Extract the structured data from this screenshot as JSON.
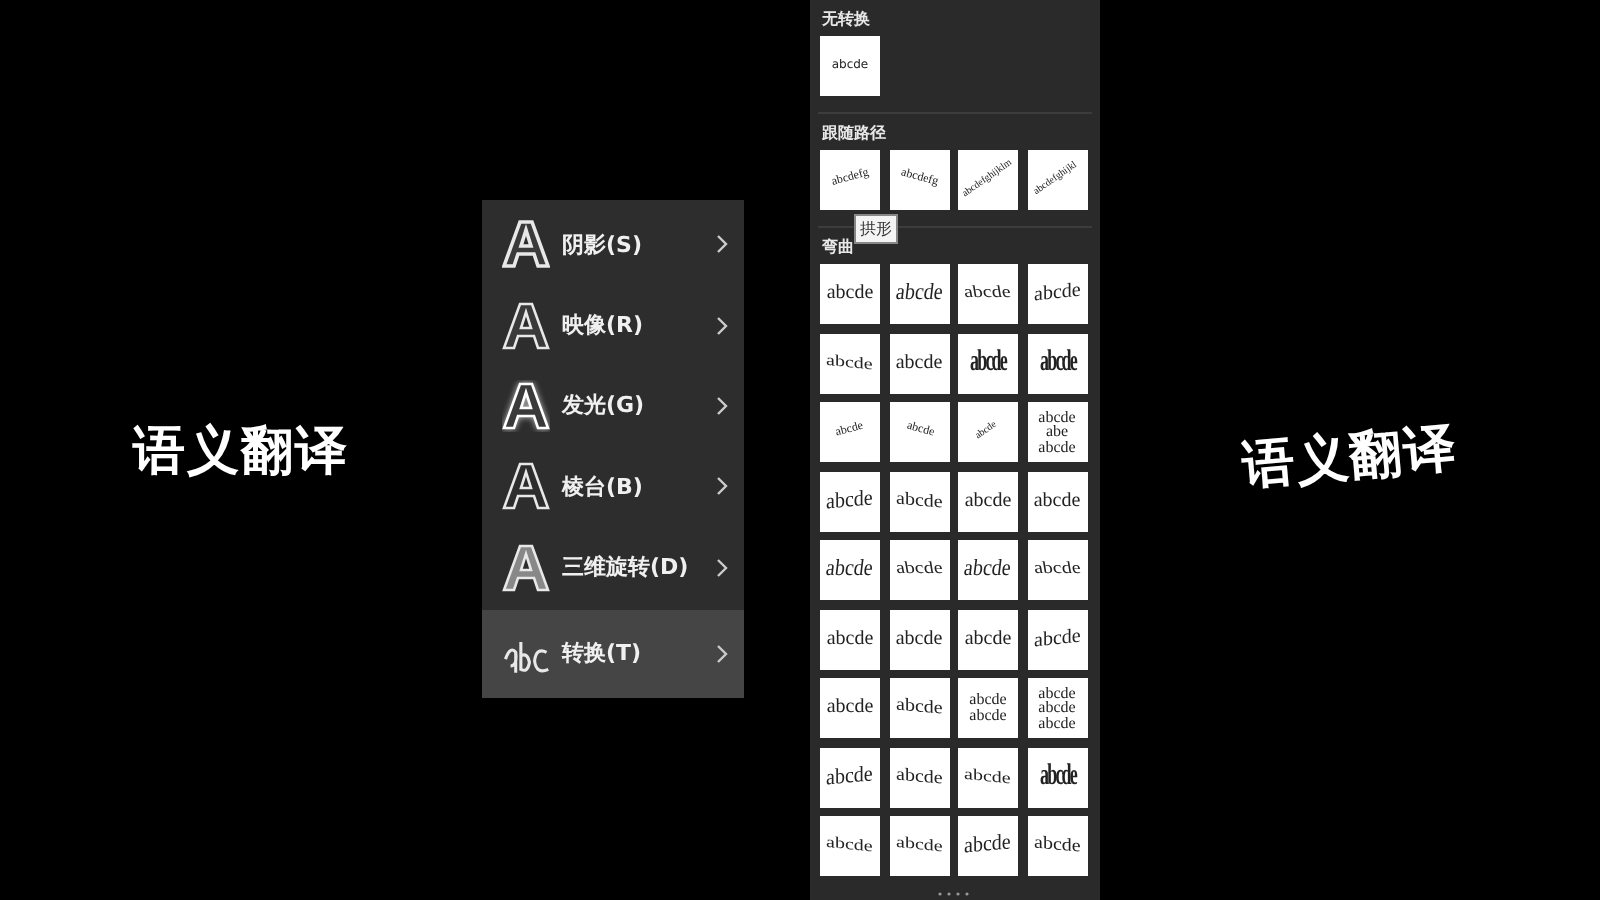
{
  "captions": [
    {
      "text": "语义翻译",
      "kind": "plain"
    },
    {
      "text": "语义翻译",
      "kind": "tilted"
    }
  ],
  "menu": {
    "items": [
      {
        "label": "阴影(S)",
        "kind": "effect",
        "selected": false
      },
      {
        "label": "映像(R)",
        "kind": "effect",
        "selected": false
      },
      {
        "label": "发光(G)",
        "kind": "effect",
        "selected": false
      },
      {
        "label": "棱台(B)",
        "kind": "effect",
        "selected": false
      },
      {
        "label": "三维旋转(D)",
        "kind": "effect",
        "selected": false
      },
      {
        "label": "转换(T)",
        "kind": "warp",
        "selected": true
      }
    ]
  },
  "gallery": {
    "sections": [
      {
        "title": "无转换",
        "tiles": [
          {
            "kind": "tiny",
            "lines": [
              "abcde"
            ]
          }
        ]
      },
      {
        "title": "跟随路径",
        "tiles": [
          {
            "kind": "arc-up",
            "lines": [
              "abcdefg"
            ]
          },
          {
            "kind": "arc-down",
            "lines": [
              "abcdefg"
            ]
          },
          {
            "kind": "circle",
            "lines": [
              "abcdefghijklm"
            ]
          },
          {
            "kind": "circle",
            "lines": [
              "abcdefghijkl"
            ]
          }
        ],
        "tooltip": "拱形"
      },
      {
        "title": "弯曲",
        "tiles": [
          {
            "kind": "plain",
            "lines": [
              "abcde"
            ]
          },
          {
            "kind": "arch-up",
            "lines": [
              "abcde"
            ]
          },
          {
            "kind": "arch-down",
            "lines": [
              "abcde"
            ]
          },
          {
            "kind": "slant",
            "lines": [
              "abcde"
            ]
          },
          {
            "kind": "wave",
            "lines": [
              "abcde"
            ]
          },
          {
            "kind": "plain",
            "lines": [
              "abcde"
            ]
          },
          {
            "kind": "squash",
            "lines": [
              "abcde"
            ]
          },
          {
            "kind": "squash",
            "lines": [
              "abcde"
            ]
          },
          {
            "kind": "arc-up",
            "lines": [
              "abcde"
            ]
          },
          {
            "kind": "arc-down",
            "lines": [
              "abcde"
            ]
          },
          {
            "kind": "circle",
            "lines": [
              "abcde"
            ]
          },
          {
            "kind": "stack",
            "lines": [
              "abcde",
              "abe",
              "abcde"
            ]
          },
          {
            "kind": "grow",
            "lines": [
              "abcde"
            ]
          },
          {
            "kind": "shrink",
            "lines": [
              "abcde"
            ]
          },
          {
            "kind": "plain",
            "lines": [
              "abcde"
            ]
          },
          {
            "kind": "plain",
            "lines": [
              "abcde"
            ]
          },
          {
            "kind": "arch-up",
            "lines": [
              "abcde"
            ]
          },
          {
            "kind": "arch-down",
            "lines": [
              "abcde"
            ]
          },
          {
            "kind": "arch-up",
            "lines": [
              "abcde"
            ]
          },
          {
            "kind": "arch-down",
            "lines": [
              "abcde"
            ]
          },
          {
            "kind": "plain",
            "lines": [
              "abcde"
            ]
          },
          {
            "kind": "plain",
            "lines": [
              "abcde"
            ]
          },
          {
            "kind": "plain",
            "lines": [
              "abcde"
            ]
          },
          {
            "kind": "slant",
            "lines": [
              "abcde"
            ]
          },
          {
            "kind": "plain",
            "lines": [
              "abcde"
            ]
          },
          {
            "kind": "shrink",
            "lines": [
              "abcde"
            ]
          },
          {
            "kind": "stack",
            "lines": [
              "abcde",
              "abcde"
            ]
          },
          {
            "kind": "stack",
            "lines": [
              "abcde",
              "abcde",
              "abcde"
            ]
          },
          {
            "kind": "grow",
            "lines": [
              "abcde"
            ]
          },
          {
            "kind": "shrink",
            "lines": [
              "abcde"
            ]
          },
          {
            "kind": "wave",
            "lines": [
              "abcde"
            ]
          },
          {
            "kind": "squash",
            "lines": [
              "abcde"
            ]
          },
          {
            "kind": "wave",
            "lines": [
              "abcde"
            ]
          },
          {
            "kind": "wave",
            "lines": [
              "abcde"
            ]
          },
          {
            "kind": "grow",
            "lines": [
              "abcde"
            ]
          },
          {
            "kind": "shrink",
            "lines": [
              "abcde"
            ]
          }
        ]
      }
    ]
  }
}
